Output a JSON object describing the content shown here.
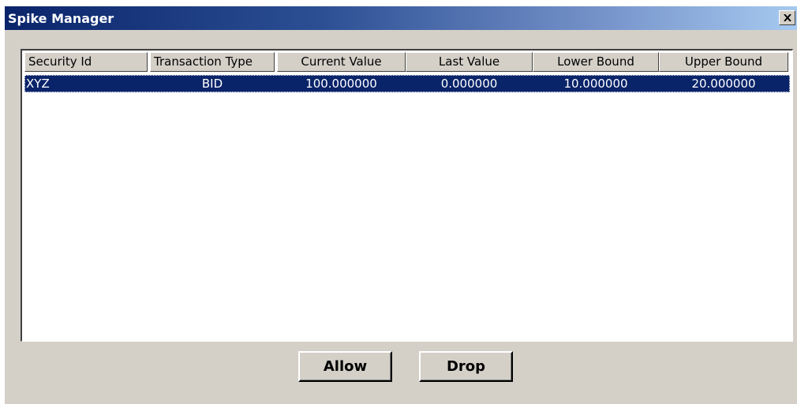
{
  "window": {
    "title": "Spike Manager"
  },
  "list": {
    "columns": [
      "Security Id",
      "Transaction Type",
      "Current Value",
      "Last Value",
      "Lower Bound",
      "Upper Bound"
    ],
    "rows": [
      {
        "security_id": "XYZ",
        "transaction_type": "BID",
        "current_value": "100.000000",
        "last_value": "0.000000",
        "lower_bound": "10.000000",
        "upper_bound": "20.000000",
        "selected": true
      }
    ]
  },
  "buttons": {
    "allow": "Allow",
    "drop": "Drop"
  },
  "colors": {
    "face": "#d4d0c8",
    "selection": "#0a246a",
    "title_start": "#0a246a",
    "title_end": "#a6caf0"
  }
}
